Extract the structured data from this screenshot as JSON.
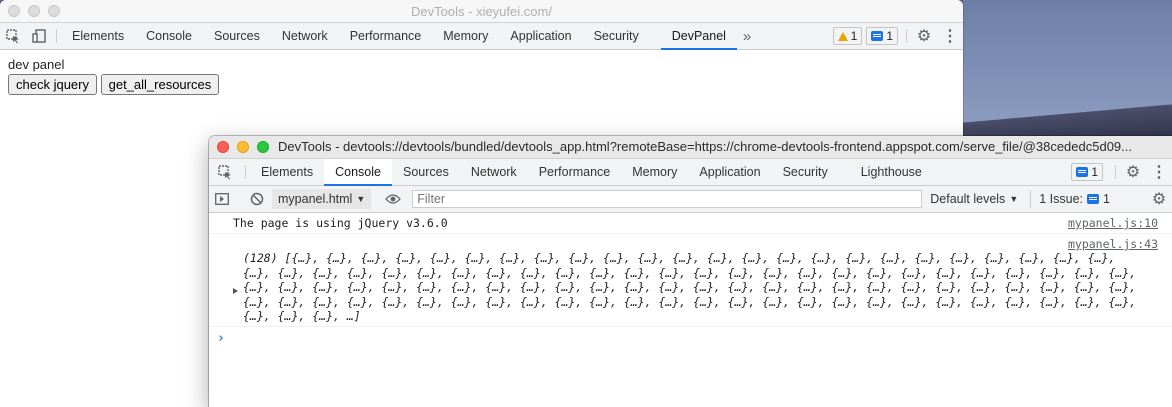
{
  "window1": {
    "title": "DevTools - xieyufei.com/",
    "tabs": [
      "Elements",
      "Console",
      "Sources",
      "Network",
      "Performance",
      "Memory",
      "Application",
      "Security",
      "DevPanel"
    ],
    "active_tab": "DevPanel",
    "more": "»",
    "warnings_count": "1",
    "messages_count": "1",
    "panel": {
      "label": "dev panel",
      "buttons": [
        "check jquery",
        "get_all_resources"
      ]
    }
  },
  "window2": {
    "title": "DevTools - devtools://devtools/bundled/devtools_app.html?remoteBase=https://chrome-devtools-frontend.appspot.com/serve_file/@38cededc5d09...",
    "tabs": [
      "Elements",
      "Console",
      "Sources",
      "Network",
      "Performance",
      "Memory",
      "Application",
      "Security",
      "Lighthouse"
    ],
    "active_tab": "Console",
    "messages_count": "1",
    "toolbar": {
      "context": "mypanel.html",
      "filter_placeholder": "Filter",
      "levels": "Default levels",
      "issues_label": "1 Issue:",
      "issues_count": "1"
    },
    "console": {
      "line1_text": "The page is using jQuery v3.6.0",
      "line1_source": "mypanel.js:10",
      "line2_source": "mypanel.js:43",
      "line2_text": "(128) [{…}, {…}, {…}, {…}, {…}, {…}, {…}, {…}, {…}, {…}, {…}, {…}, {…}, {…}, {…}, {…}, {…}, {…}, {…}, {…}, {…}, {…}, {…}, {…}, {…}, {…}, {…}, {…}, {…}, {…}, {…}, {…}, {…}, {…}, {…}, {…}, {…}, {…}, {…}, {…}, {…}, {…}, {…}, {…}, {…}, {…}, {…}, {…}, {…}, {…}, {…}, {…}, {…}, {…}, {…}, {…}, {…}, {…}, {…}, {…}, {…}, {…}, {…}, {…}, {…}, {…}, {…}, {…}, {…}, {…}, {…}, {…}, {…}, {…}, {…}, {…}, {…}, {…}, {…}, {…}, {…}, {…}, {…}, {…}, {…}, {…}, {…}, {…}, {…}, {…}, {…}, {…}, {…}, {…}, {…}, {…}, {…}, {…}, {…}, {…}, {…}, {…}, {…}, {…}, {…}, …]",
      "prompt": "›"
    }
  }
}
